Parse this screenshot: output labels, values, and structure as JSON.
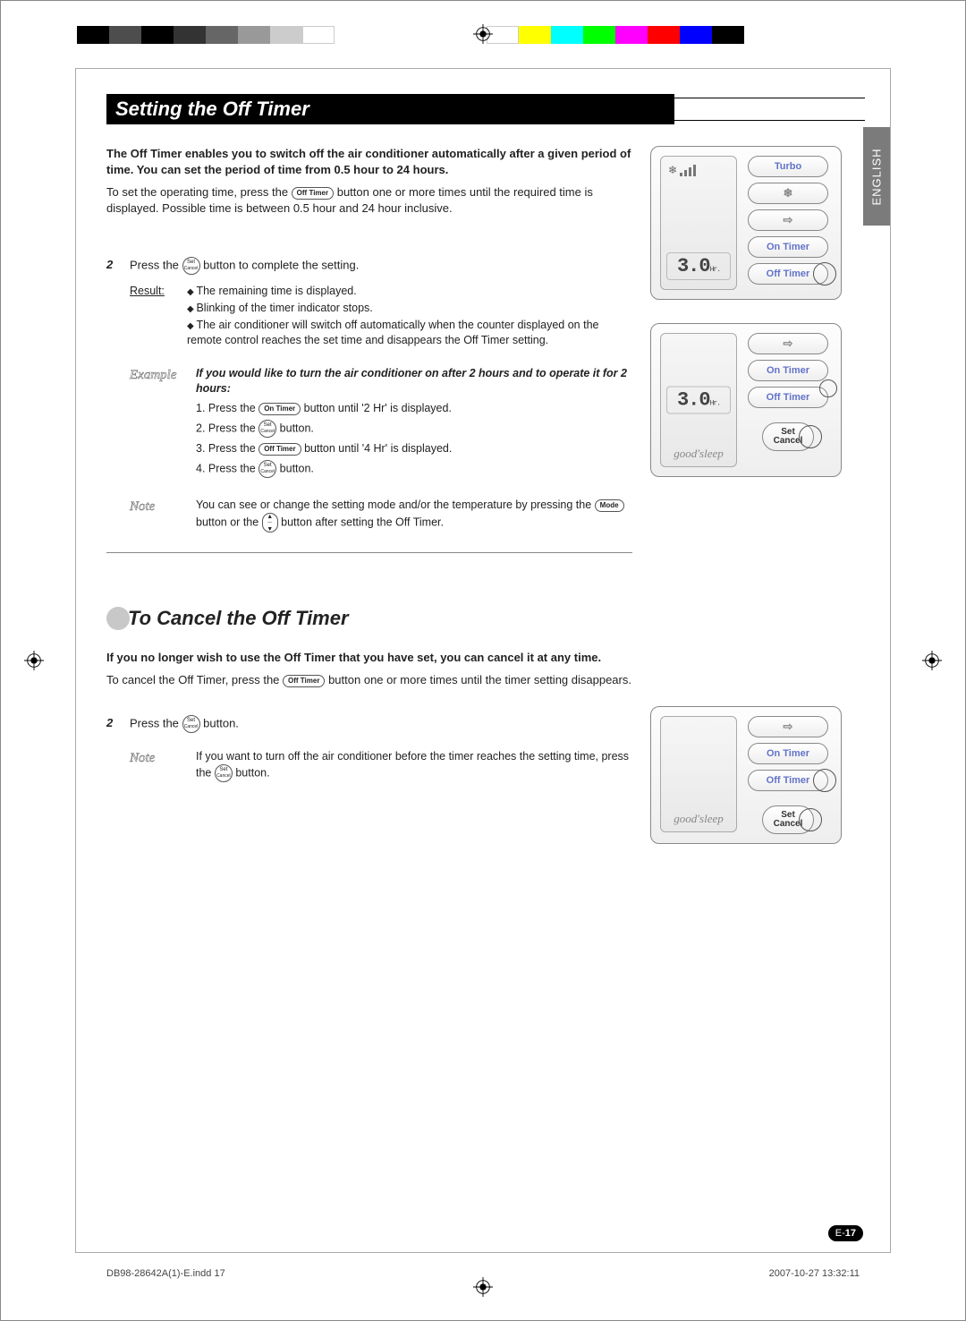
{
  "lang_tab": "ENGLISH",
  "heading1": "Setting the Off Timer",
  "intro1": "The Off Timer enables you to switch off the air conditioner automatically after a given period of time. You can set the period of time from 0.5 hour to 24 hours.",
  "p1a": "To set the operating time, press the ",
  "p1b": " button one or more times until the required time is displayed. Possible time is between 0.5 hour and 24 hour inclusive.",
  "step2_num": "2",
  "step2a": "Press the ",
  "step2b": " button to complete the setting.",
  "result_label": "Result:",
  "result_items": [
    "The remaining time is displayed.",
    "Blinking of the timer indicator stops.",
    "The air conditioner will switch off automatically when the counter displayed on the remote control reaches the set time and disappears the Off Timer setting."
  ],
  "example_label": "Example",
  "example_lead": "If you would like to turn the air conditioner on after 2 hours and to operate it for 2 hours:",
  "example_steps_a": [
    "1. Press the ",
    "2. Press the ",
    "3. Press the ",
    "4. Press the "
  ],
  "example_steps_b": [
    " button until '2 Hr' is displayed.",
    " button.",
    " button until '4 Hr' is displayed.",
    " button."
  ],
  "note_label": "Note",
  "note_a": "You can see or change the setting mode and/or the temperature by pressing the ",
  "note_mid": " button or the ",
  "note_b": " button after setting the Off Timer.",
  "heading2": "To Cancel the Off Timer",
  "intro2": "If you no longer wish to use the Off Timer that you have set, you can cancel it at any time.",
  "cancel_a": "To cancel the Off Timer, press the ",
  "cancel_b": " button one or more times until the timer setting disappears.",
  "cstep2_num": "2",
  "cstep2a": "Press the ",
  "cstep2b": " button.",
  "cnote_a": "If you want to turn off the air conditioner before the timer reaches the setting time, press the ",
  "cnote_b": " button.",
  "btn": {
    "off_timer": "Off Timer",
    "on_timer": "On Timer",
    "mode": "Mode",
    "set": "Set",
    "cancel": "Cancel",
    "power": "⏻"
  },
  "remote": {
    "readout": "3.0",
    "hr": "Hr.",
    "goodsleep": "good'sleep",
    "turbo": "Turbo",
    "fan": "❄",
    "swing": "⇨",
    "on_timer": "On Timer",
    "off_timer": "Off Timer",
    "set": "Set",
    "cancel": "Cancel"
  },
  "page_prefix": "E-",
  "page_num": "17",
  "footer_left": "DB98-28642A(1)-E.indd   17",
  "footer_right": "2007-10-27   13:32:11"
}
